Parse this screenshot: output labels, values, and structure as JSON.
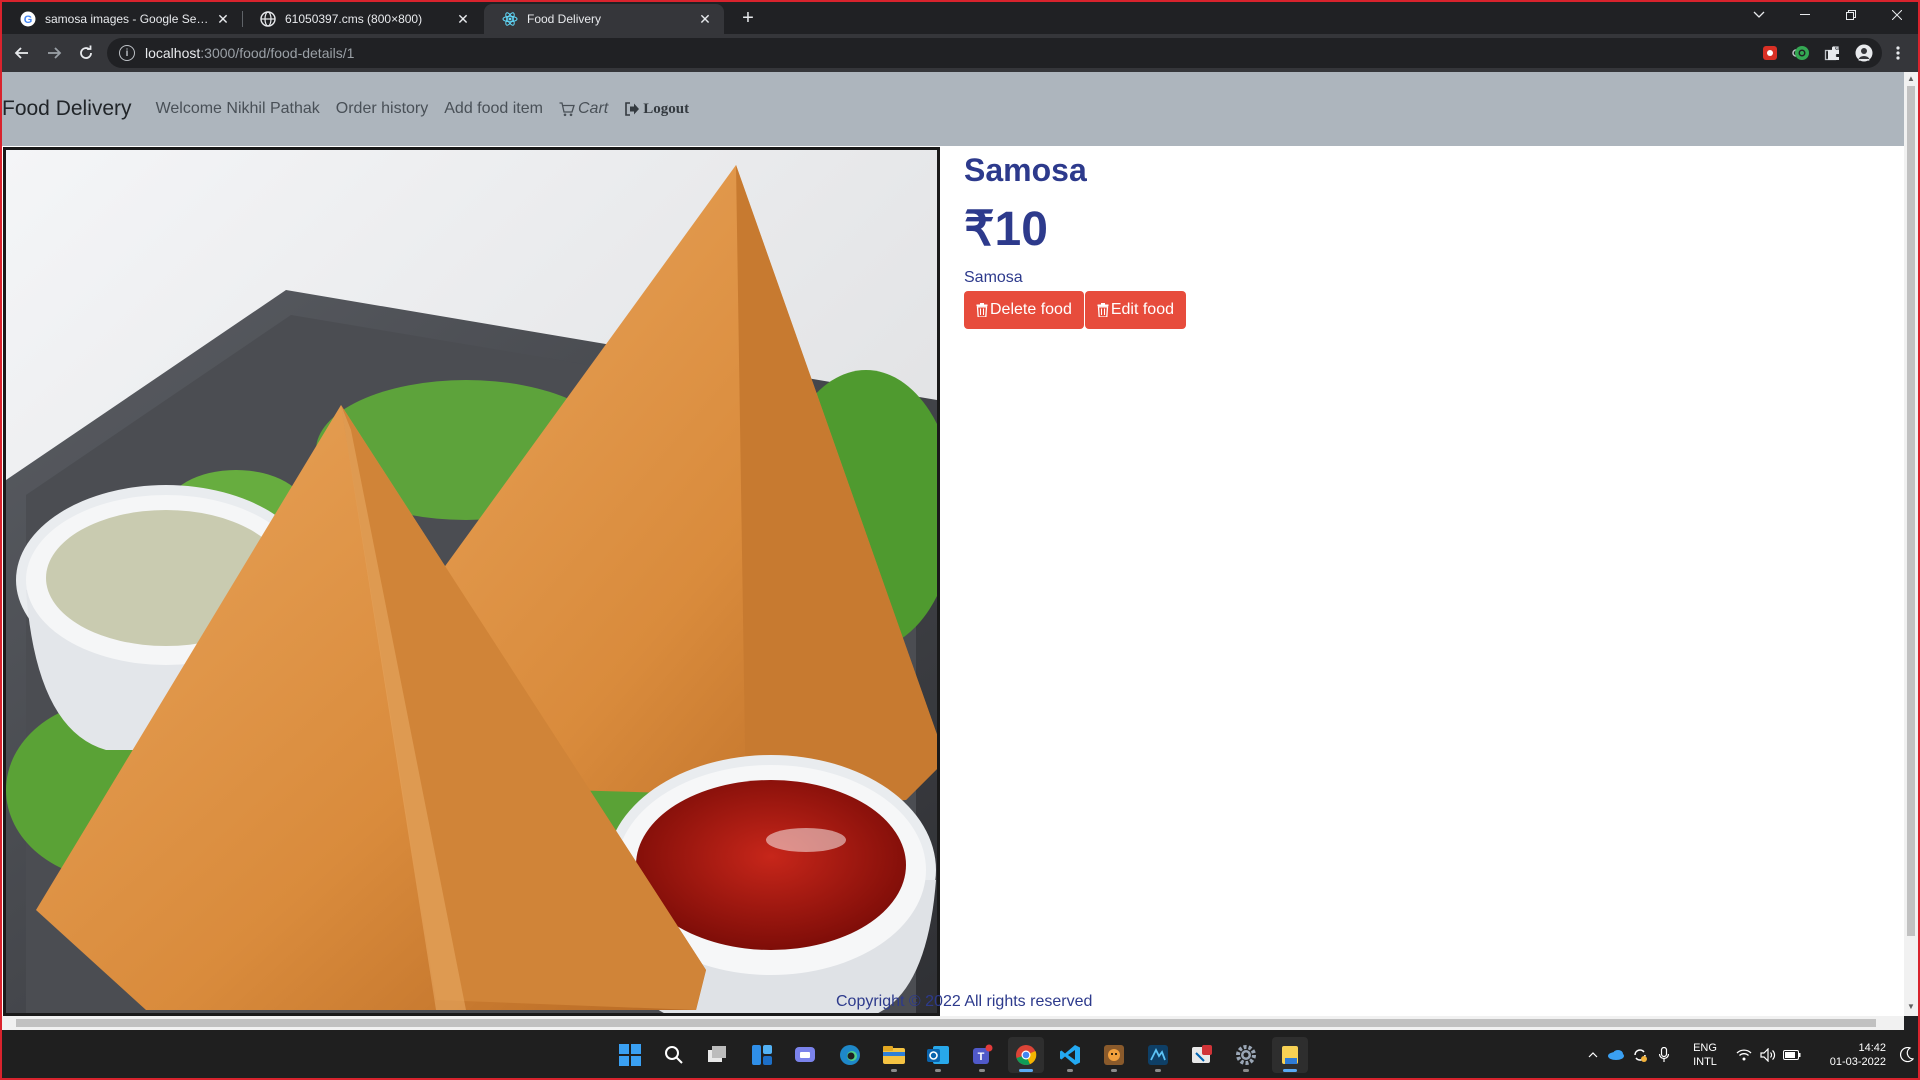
{
  "browser": {
    "tabs": [
      {
        "title": "samosa images - Google Search",
        "favicon": "google-icon",
        "active": false
      },
      {
        "title": "61050397.cms (800×800)",
        "favicon": "globe-icon",
        "active": false
      },
      {
        "title": "Food Delivery",
        "favicon": "react-icon",
        "active": true
      }
    ],
    "url_host": "localhost",
    "url_path": ":3000/food/food-details/1"
  },
  "navbar": {
    "brand": "Food Delivery",
    "welcome": "Welcome Nikhil Pathak",
    "order_history": "Order history",
    "add_food": "Add food item",
    "cart": "Cart",
    "logout": "Logout"
  },
  "food": {
    "name": "Samosa",
    "price": "₹10",
    "description": "Samosa",
    "delete_label": "Delete food",
    "edit_label": "Edit food"
  },
  "footer": {
    "copyright": "Copyright © 2022 All rights reserved"
  },
  "taskbar": {
    "lang_top": "ENG",
    "lang_bottom": "INTL",
    "time": "14:42",
    "date": "01-03-2022"
  },
  "colors": {
    "navbar_bg": "#adb5bd",
    "text_accent": "#2d3a8c",
    "danger": "#e74c3c"
  }
}
